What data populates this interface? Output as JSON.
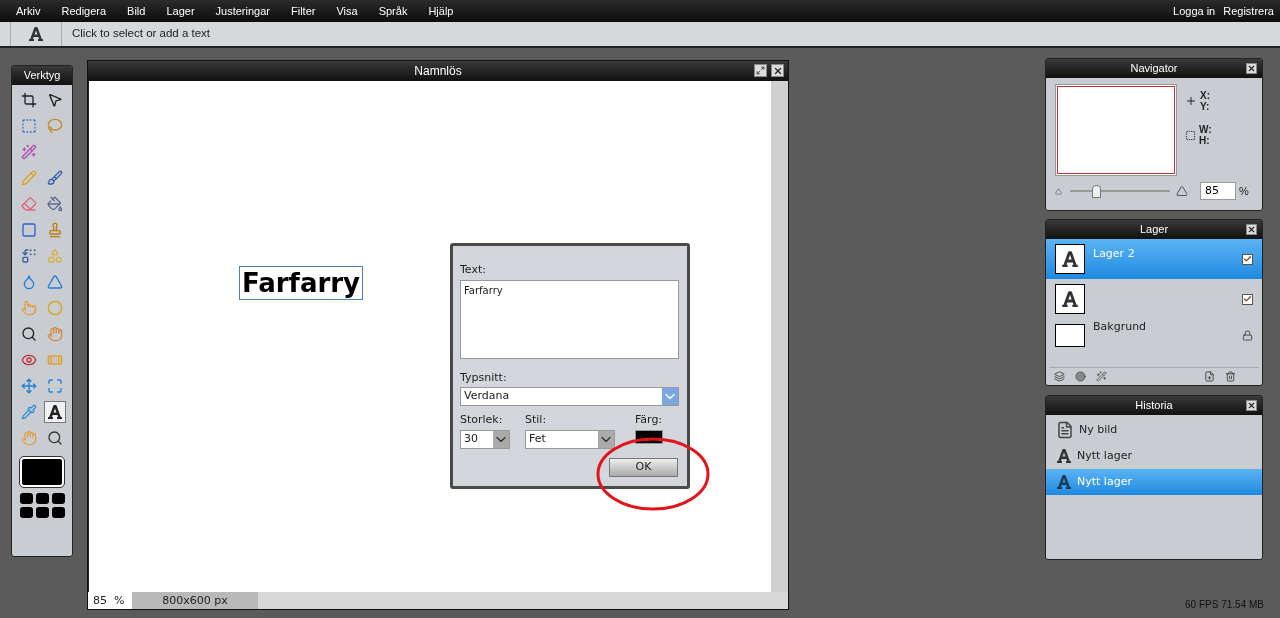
{
  "menu": {
    "items": [
      "Arkiv",
      "Redigera",
      "Bild",
      "Lager",
      "Justeringar",
      "Filter",
      "Visa",
      "Språk",
      "Hjälp"
    ],
    "account": [
      "Logga in",
      "Registrera"
    ]
  },
  "options_bar": {
    "hint": "Click to select or add a text"
  },
  "tools": {
    "title": "Verktyg",
    "items": [
      {
        "selected": false
      },
      {
        "selected": false
      },
      {
        "selected": false
      },
      {
        "selected": false
      },
      {
        "selected": false
      },
      {
        "selected": false
      },
      {
        "selected": false
      },
      {
        "selected": false
      },
      {
        "selected": false
      },
      {
        "selected": false
      },
      {
        "selected": false
      },
      {
        "selected": false
      },
      {
        "selected": false
      },
      {
        "selected": false
      },
      {
        "selected": false
      },
      {
        "selected": false
      },
      {
        "selected": false
      },
      {
        "selected": false
      },
      {
        "selected": false
      },
      {
        "selected": false
      },
      {
        "selected": false
      },
      {
        "selected": false
      },
      {
        "selected": false
      },
      {
        "selected": false
      },
      {
        "selected": true
      },
      {
        "selected": false
      },
      {
        "selected": false
      }
    ]
  },
  "document": {
    "title": "Namnlös",
    "canvas_text": "Farfarry",
    "zoom": "85",
    "zoom_unit": "%",
    "size": "800x600 px"
  },
  "text_dialog": {
    "text_label": "Text:",
    "text_value": "Farfarry",
    "font_label": "Typsnitt:",
    "font_value": "Verdana",
    "size_label": "Storlek:",
    "size_value": "30",
    "style_label": "Stil:",
    "style_value": "Fet",
    "color_label": "Färg:",
    "ok": "OK"
  },
  "navigator": {
    "title": "Navigator",
    "x_label": "X:",
    "y_label": "Y:",
    "w_label": "W:",
    "h_label": "H:",
    "zoom": {
      "level": 0.26
    },
    "zoom_value": "85",
    "zoom_unit": "%"
  },
  "layers": {
    "title": "Lager",
    "items": [
      {
        "kind": "text",
        "name": "Lager 2",
        "selected": true,
        "locked": false,
        "visible": true
      },
      {
        "kind": "text",
        "selected": false,
        "locked": false,
        "visible": true
      },
      {
        "kind": "image",
        "name": "Bakgrund",
        "selected": false,
        "locked": true
      }
    ]
  },
  "history": {
    "title": "Historia",
    "items": [
      {
        "kind": "document",
        "label": "Ny bild",
        "selected": false
      },
      {
        "kind": "text",
        "label": "Nytt lager",
        "selected": false
      },
      {
        "kind": "text",
        "label": "Nytt lager",
        "selected": true
      }
    ]
  },
  "status": "60 FPS 71.54 MB"
}
